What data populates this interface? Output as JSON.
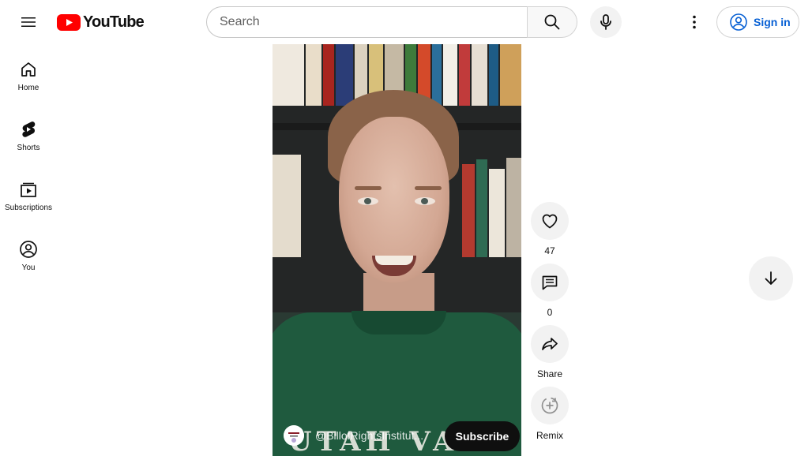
{
  "header": {
    "logo_text": "YouTube",
    "search_placeholder": "Search",
    "signin_label": "Sign in"
  },
  "sidebar": {
    "items": [
      {
        "label": "Home",
        "icon": "home-icon"
      },
      {
        "label": "Shorts",
        "icon": "shorts-icon"
      },
      {
        "label": "Subscriptions",
        "icon": "subscriptions-icon"
      },
      {
        "label": "You",
        "icon": "you-icon"
      }
    ]
  },
  "video": {
    "channel_handle": "@BillofRightsInstitut...",
    "subscribe_label": "Subscribe",
    "shirt_text": "UTAH VALL"
  },
  "actions": {
    "like_count": "47",
    "comment_count": "0",
    "share_label": "Share",
    "remix_label": "Remix"
  },
  "colors": {
    "brand_red": "#ff0000",
    "link_blue": "#065fd4",
    "button_gray": "#f2f2f2"
  }
}
